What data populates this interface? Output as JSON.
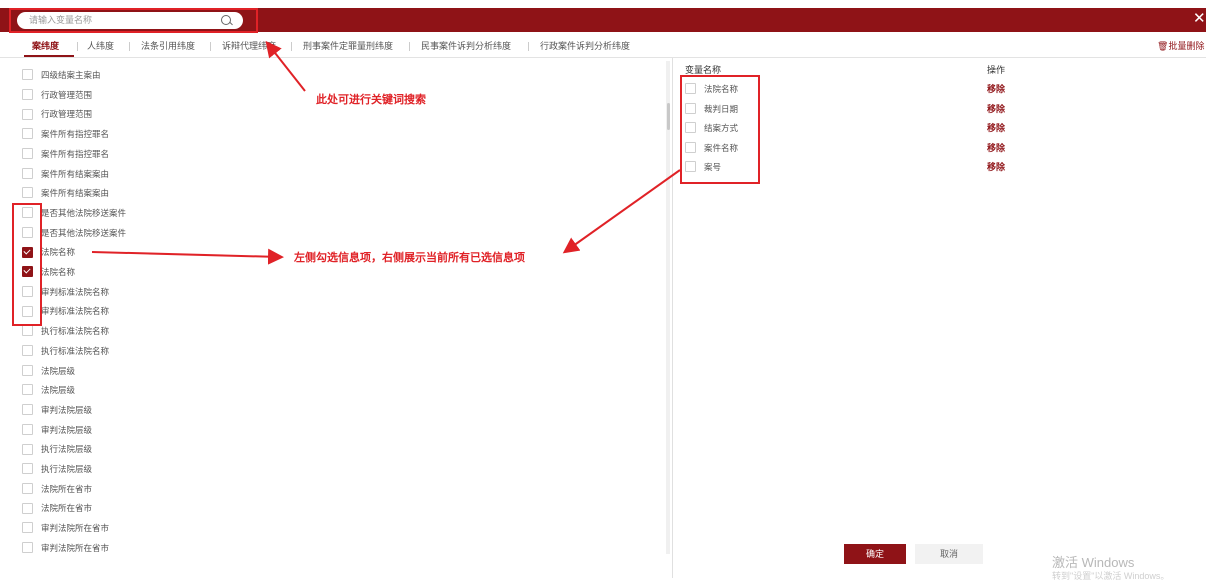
{
  "search": {
    "placeholder": "请输入变量名称"
  },
  "tabs": [
    {
      "label": "案纬度",
      "active": true
    },
    {
      "label": "人纬度"
    },
    {
      "label": "法条引用纬度"
    },
    {
      "label": "诉辩代理纬度"
    },
    {
      "label": "刑事案件定罪量刑纬度"
    },
    {
      "label": "民事案件诉判分析纬度"
    },
    {
      "label": "行政案件诉判分析纬度"
    }
  ],
  "toolbar": {
    "batch_delete_label": "批量删除"
  },
  "left_items": [
    {
      "label": "四级结案主案由",
      "checked": false
    },
    {
      "label": "行政管理范围",
      "checked": false
    },
    {
      "label": "行政管理范围",
      "checked": false
    },
    {
      "label": "案件所有指控罪名",
      "checked": false
    },
    {
      "label": "案件所有指控罪名",
      "checked": false
    },
    {
      "label": "案件所有结案案由",
      "checked": false
    },
    {
      "label": "案件所有结案案由",
      "checked": false
    },
    {
      "label": "是否其他法院移送案件",
      "checked": false
    },
    {
      "label": "是否其他法院移送案件",
      "checked": false
    },
    {
      "label": "法院名称",
      "checked": true
    },
    {
      "label": "法院名称",
      "checked": true
    },
    {
      "label": "审判标准法院名称",
      "checked": false
    },
    {
      "label": "审判标准法院名称",
      "checked": false
    },
    {
      "label": "执行标准法院名称",
      "checked": false
    },
    {
      "label": "执行标准法院名称",
      "checked": false
    },
    {
      "label": "法院层级",
      "checked": false
    },
    {
      "label": "法院层级",
      "checked": false
    },
    {
      "label": "审判法院层级",
      "checked": false
    },
    {
      "label": "审判法院层级",
      "checked": false
    },
    {
      "label": "执行法院层级",
      "checked": false
    },
    {
      "label": "执行法院层级",
      "checked": false
    },
    {
      "label": "法院所在省市",
      "checked": false
    },
    {
      "label": "法院所在省市",
      "checked": false
    },
    {
      "label": "审判法院所在省市",
      "checked": false
    },
    {
      "label": "审判法院所在省市",
      "checked": false
    }
  ],
  "right_panel": {
    "col_name_header": "变量名称",
    "col_action_header": "操作",
    "remove_label": "移除",
    "items": [
      {
        "label": "法院名称"
      },
      {
        "label": "裁判日期"
      },
      {
        "label": "结案方式"
      },
      {
        "label": "案件名称"
      },
      {
        "label": "案号"
      }
    ]
  },
  "buttons": {
    "confirm": "确定",
    "cancel": "取消"
  },
  "watermark": {
    "line1": "激活 Windows",
    "line2": "转到\"设置\"以激活 Windows。"
  },
  "annotations": {
    "search_hint": "此处可进行关键词搜索",
    "select_hint": "左侧勾选信息项，右侧展示当前所有已选信息项"
  },
  "colors": {
    "brand": "#8f1317",
    "annotation": "#e02227"
  },
  "icons": {
    "search": "search-icon",
    "close": "close-icon",
    "trash": "trash-icon"
  }
}
